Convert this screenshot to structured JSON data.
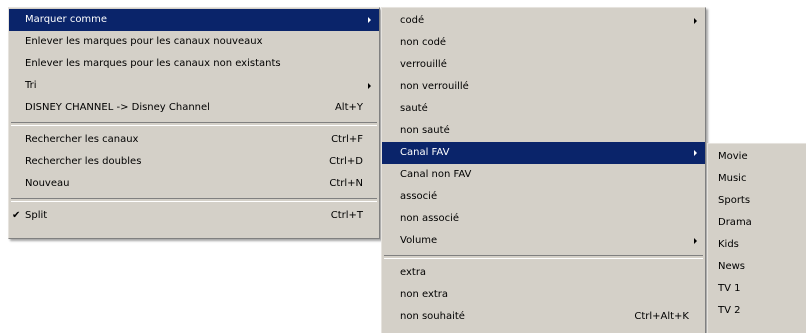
{
  "menu_main": {
    "items": [
      {
        "label": "Marquer comme",
        "shortcut": ""
      },
      {
        "label": "Enlever les marques pour les canaux nouveaux",
        "shortcut": ""
      },
      {
        "label": "Enlever les marques pour les canaux non existants",
        "shortcut": ""
      },
      {
        "label": "Tri",
        "shortcut": ""
      },
      {
        "label": "DISNEY CHANNEL -> Disney Channel",
        "shortcut": "Alt+Y"
      },
      {
        "label": "Rechercher les canaux",
        "shortcut": "Ctrl+F"
      },
      {
        "label": "Rechercher les doubles",
        "shortcut": "Ctrl+D"
      },
      {
        "label": "Nouveau",
        "shortcut": "Ctrl+N"
      },
      {
        "label": "Split",
        "shortcut": "Ctrl+T",
        "check": "✔"
      }
    ]
  },
  "menu_mark": {
    "items": [
      {
        "label": "codé"
      },
      {
        "label": "non codé"
      },
      {
        "label": "verrouillé"
      },
      {
        "label": "non verrouillé"
      },
      {
        "label": "sauté"
      },
      {
        "label": "non sauté"
      },
      {
        "label": "Canal FAV"
      },
      {
        "label": "Canal non FAV"
      },
      {
        "label": "associé"
      },
      {
        "label": "non associé"
      },
      {
        "label": "Volume"
      },
      {
        "label": "extra"
      },
      {
        "label": "non extra"
      },
      {
        "label": "non souhaité",
        "shortcut": "Ctrl+Alt+K"
      }
    ]
  },
  "menu_fav": {
    "items": [
      {
        "label": "Movie"
      },
      {
        "label": "Music"
      },
      {
        "label": "Sports"
      },
      {
        "label": "Drama"
      },
      {
        "label": "Kids"
      },
      {
        "label": "News"
      },
      {
        "label": "TV 1"
      },
      {
        "label": "TV 2"
      }
    ]
  },
  "colors": {
    "menu_bg": "#d4d0c8",
    "highlight_bg": "#0a246a",
    "highlight_text": "#ffffff"
  }
}
